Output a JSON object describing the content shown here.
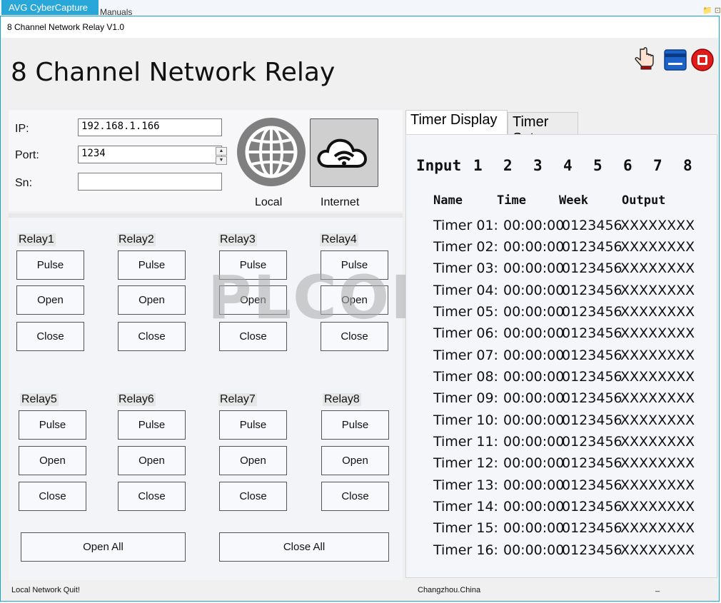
{
  "os": {
    "avg_tab": "AVG CyberCapture",
    "manuals": "Manuals"
  },
  "window": {
    "title": "8 Channel Network Relay V1.0"
  },
  "app": {
    "heading": "8 Channel Network Relay"
  },
  "toolbar_icons": [
    "hand-pointer-icon",
    "card-icon",
    "stop-icon"
  ],
  "connection": {
    "ip_label": "IP:",
    "ip_value": "192.168.1.166",
    "port_label": "Port:",
    "port_value": "1234",
    "sn_label": "Sn:",
    "sn_value": "",
    "local_label": "Local",
    "internet_label": "Internet"
  },
  "relays": [
    {
      "label": "Relay1",
      "pulse": "Pulse",
      "open": "Open",
      "close": "Close"
    },
    {
      "label": "Relay2",
      "pulse": "Pulse",
      "open": "Open",
      "close": "Close"
    },
    {
      "label": "Relay3",
      "pulse": "Pulse",
      "open": "Open",
      "close": "Close"
    },
    {
      "label": "Relay4",
      "pulse": "Pulse",
      "open": "Open",
      "close": "Close"
    },
    {
      "label": "Relay5",
      "pulse": "Pulse",
      "open": "Open",
      "close": "Close"
    },
    {
      "label": "Relay6",
      "pulse": "Pulse",
      "open": "Open",
      "close": "Close"
    },
    {
      "label": "Relay7",
      "pulse": "Pulse",
      "open": "Open",
      "close": "Close"
    },
    {
      "label": "Relay8",
      "pulse": "Pulse",
      "open": "Open",
      "close": "Close"
    }
  ],
  "open_all": "Open All",
  "close_all": "Close All",
  "watermark": "PLCOME",
  "tabs": {
    "display": "Timer Display",
    "set": "Timer Set"
  },
  "input_row": {
    "label": "Input",
    "numbers": [
      "1",
      "2",
      "3",
      "4",
      "5",
      "6",
      "7",
      "8"
    ]
  },
  "timer_headers": {
    "name": "Name",
    "time": "Time",
    "week": "Week",
    "output": "Output"
  },
  "timers": [
    {
      "name": "Timer 01:",
      "time": "00:00:00",
      "week": "0123456",
      "output": "XXXXXXXX"
    },
    {
      "name": "Timer 02:",
      "time": "00:00:00",
      "week": "0123456",
      "output": "XXXXXXXX"
    },
    {
      "name": "Timer 03:",
      "time": "00:00:00",
      "week": "0123456",
      "output": "XXXXXXXX"
    },
    {
      "name": "Timer 04:",
      "time": "00:00:00",
      "week": "0123456",
      "output": "XXXXXXXX"
    },
    {
      "name": "Timer 05:",
      "time": "00:00:00",
      "week": "0123456",
      "output": "XXXXXXXX"
    },
    {
      "name": "Timer 06:",
      "time": "00:00:00",
      "week": "0123456",
      "output": "XXXXXXXX"
    },
    {
      "name": "Timer 07:",
      "time": "00:00:00",
      "week": "0123456",
      "output": "XXXXXXXX"
    },
    {
      "name": "Timer 08:",
      "time": "00:00:00",
      "week": "0123456",
      "output": "XXXXXXXX"
    },
    {
      "name": "Timer 09:",
      "time": "00:00:00",
      "week": "0123456",
      "output": "XXXXXXXX"
    },
    {
      "name": "Timer 10:",
      "time": "00:00:00",
      "week": "0123456",
      "output": "XXXXXXXX"
    },
    {
      "name": "Timer 11:",
      "time": "00:00:00",
      "week": "0123456",
      "output": "XXXXXXXX"
    },
    {
      "name": "Timer 12:",
      "time": "00:00:00",
      "week": "0123456",
      "output": "XXXXXXXX"
    },
    {
      "name": "Timer 13:",
      "time": "00:00:00",
      "week": "0123456",
      "output": "XXXXXXXX"
    },
    {
      "name": "Timer 14:",
      "time": "00:00:00",
      "week": "0123456",
      "output": "XXXXXXXX"
    },
    {
      "name": "Timer 15:",
      "time": "00:00:00",
      "week": "0123456",
      "output": "XXXXXXXX"
    },
    {
      "name": "Timer 16:",
      "time": "00:00:00",
      "week": "0123456",
      "output": "XXXXXXXX"
    }
  ],
  "status": {
    "left": "Local Network Quit!",
    "middle": "Changzhou.China",
    "right": "_"
  }
}
